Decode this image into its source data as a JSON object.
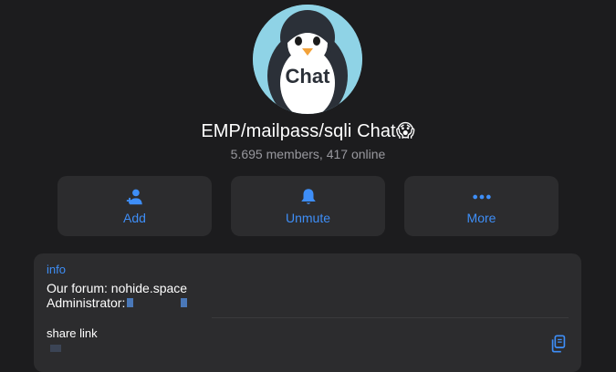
{
  "avatar": {
    "text": "Chat",
    "icon": "penguin-avatar",
    "bg_color": "#8fd3e6"
  },
  "header": {
    "title": "EMP/mailpass/sqli Chat😱",
    "subtitle": "5.695 members, 417 online"
  },
  "actions": [
    {
      "label": "Add",
      "icon": "add-user-icon"
    },
    {
      "label": "Unmute",
      "icon": "bell-icon"
    },
    {
      "label": "More",
      "icon": "ellipsis-icon"
    }
  ],
  "info": {
    "heading": "info",
    "line1": "Our forum: nohide.space",
    "line2": "Administrator:",
    "share_label": "share link",
    "copy_icon": "copy-icon"
  },
  "colors": {
    "accent": "#3e8ef7",
    "background": "#1c1c1e",
    "card": "#2c2c2e",
    "muted_text": "#98989e"
  }
}
